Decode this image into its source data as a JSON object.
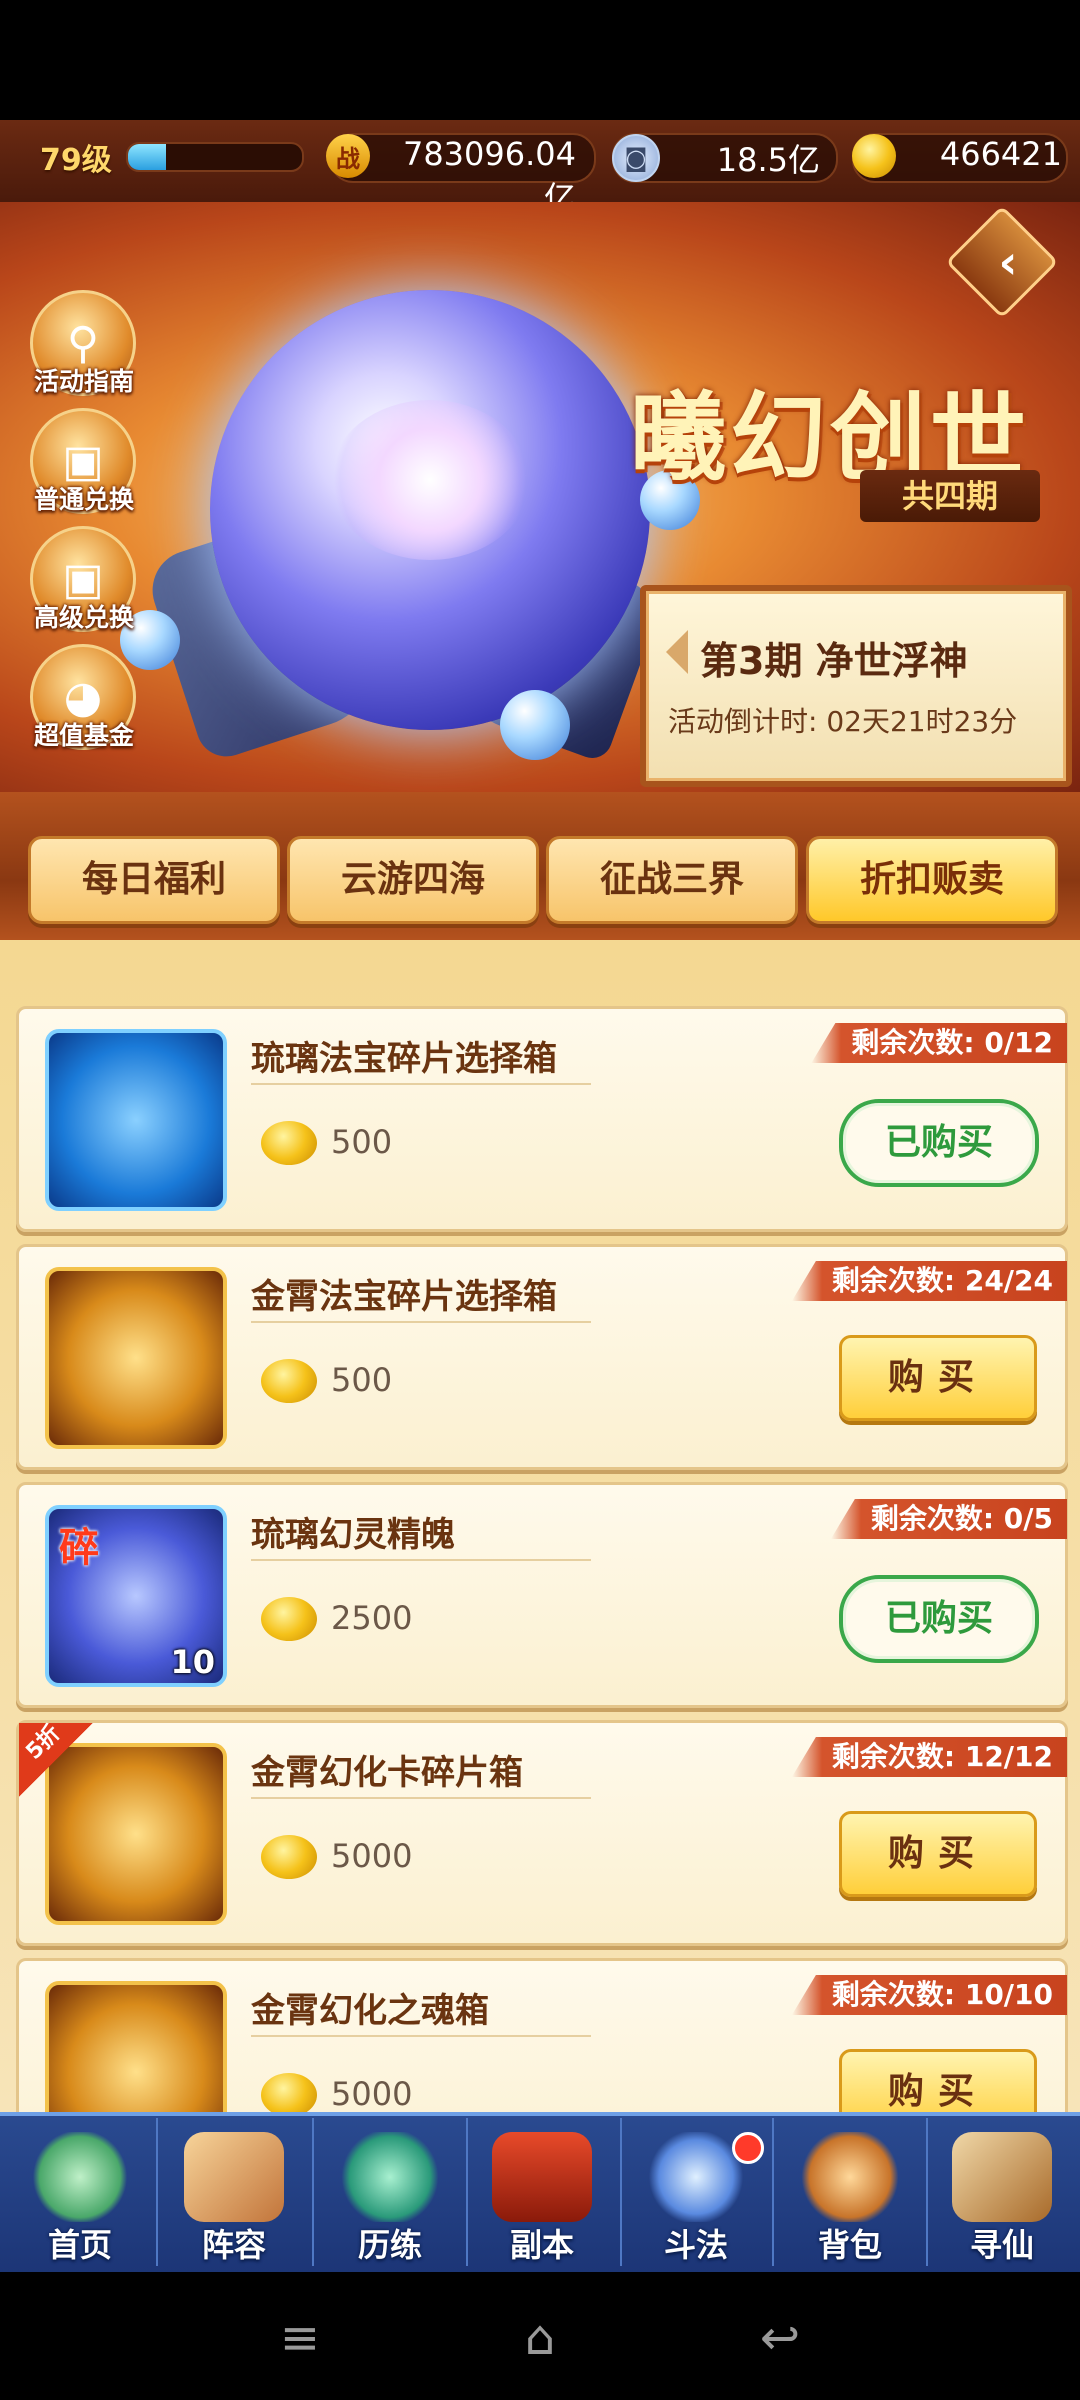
{
  "resources": {
    "level": "79级",
    "level_xp_fraction": 0.22,
    "power_icon": "战",
    "power": "783096.04亿",
    "copper": "18.5亿",
    "gold": "466421"
  },
  "banner": {
    "title": "曦幻创世",
    "period_count": "共四期",
    "current_period": "第3期  净世浮神",
    "countdown": "活动倒计时: 02天21时23分"
  },
  "side_buttons": [
    {
      "label": "活动指南",
      "icon": "magnifier-icon"
    },
    {
      "label": "普通兑换",
      "icon": "gift-box-icon"
    },
    {
      "label": "高级兑换",
      "icon": "gift-box-icon"
    },
    {
      "label": "超值基金",
      "icon": "treasure-pot-icon"
    }
  ],
  "tabs": [
    {
      "label": "每日福利",
      "active": false
    },
    {
      "label": "云游四海",
      "active": false
    },
    {
      "label": "征战三界",
      "active": false
    },
    {
      "label": "折扣贩卖",
      "active": true
    }
  ],
  "items": [
    {
      "name": "琉璃法宝碎片选择箱",
      "price": "500",
      "remaining": "剩余次数: 0/12",
      "button": "已购买",
      "state": "bought"
    },
    {
      "name": "金霄法宝碎片选择箱",
      "price": "500",
      "remaining": "剩余次数: 24/24",
      "button": "购买",
      "state": "buy"
    },
    {
      "name": "琉璃幻灵精魄",
      "price": "2500",
      "remaining": "剩余次数: 0/5",
      "button": "已购买",
      "state": "bought",
      "fragment_mark": "碎",
      "stack": "10"
    },
    {
      "name": "金霄幻化卡碎片箱",
      "price": "5000",
      "remaining": "剩余次数: 12/12",
      "button": "购买",
      "state": "buy",
      "discount": "5折"
    },
    {
      "name": "金霄幻化之魂箱",
      "price": "5000",
      "remaining": "剩余次数: 10/10",
      "button": "购买",
      "state": "buy"
    }
  ],
  "bottom_nav": [
    {
      "label": "首页"
    },
    {
      "label": "阵容"
    },
    {
      "label": "历练"
    },
    {
      "label": "副本"
    },
    {
      "label": "斗法"
    },
    {
      "label": "背包"
    },
    {
      "label": "寻仙"
    }
  ],
  "system_nav": {
    "menu": "≡",
    "home": "⌂",
    "back": "↩"
  }
}
